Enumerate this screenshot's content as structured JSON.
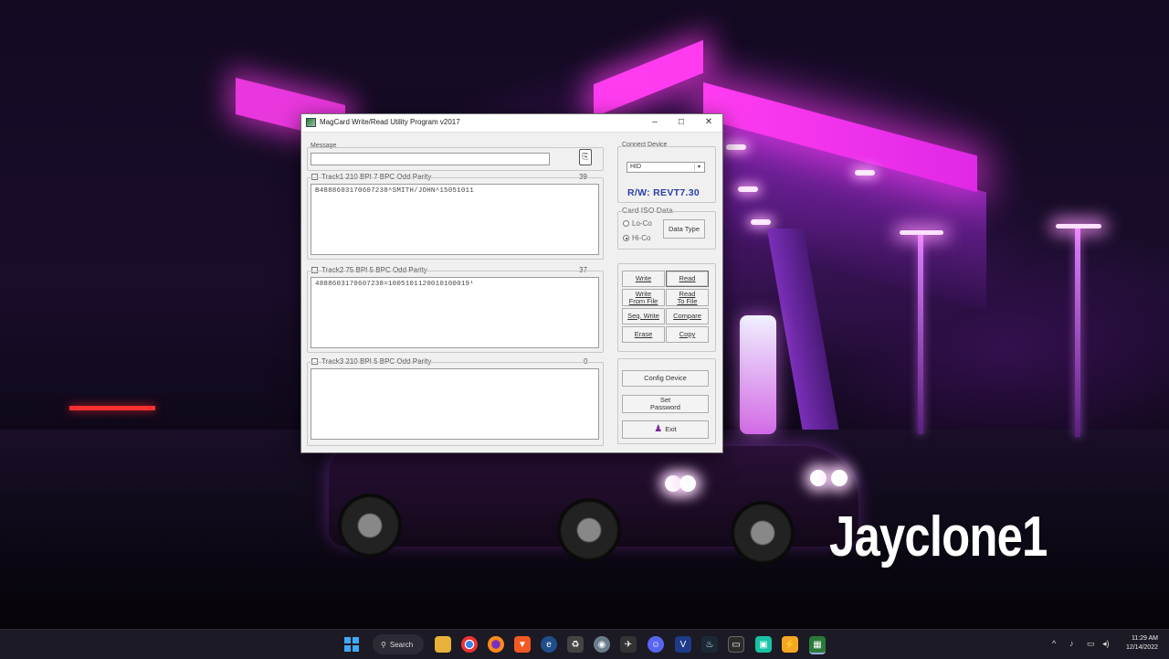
{
  "window": {
    "title": "MagCard Write/Read Utility Program  v2017",
    "controls": {
      "minimize": "–",
      "maximize": "☐",
      "close": "✕"
    }
  },
  "message": {
    "label": "Message",
    "value": ""
  },
  "tracks": [
    {
      "label": "Track1   210 BPI 7 BPC Odd Parity",
      "count": "39",
      "data": "B4888603170607238^SMITH/JOHN^15051011"
    },
    {
      "label": "Track2   75 BPI 5 BPC Odd Parity",
      "count": "37",
      "data": "4888603170607238=1005101120010100019¹"
    },
    {
      "label": "Track3   210 BPI 5 BPC Odd Parity",
      "count": "0",
      "data": ""
    }
  ],
  "connect": {
    "label": "Connect Device",
    "device": "HID",
    "version": "R/W: REVT7.30"
  },
  "iso": {
    "label": "Card ISO Data",
    "options": [
      "Lo-Co",
      "Hi-Co"
    ],
    "selected": "Hi-Co",
    "data_type_button": "Data Type"
  },
  "actions": {
    "write": "Write",
    "read": "Read",
    "write_from_file": "Write\nFrom File",
    "read_to_file": "Read\nTo File",
    "seq_write": "Seq. Write",
    "compare": "Compare",
    "erase": "Erase",
    "copy": "Copy"
  },
  "config": {
    "config_device": "Config Device",
    "set_password": "Set\nPassword",
    "exit": "Exit"
  },
  "watermark": "Jayclone1",
  "taskbar": {
    "search": "Search",
    "time": "11:29 AM",
    "date": "12/14/2022"
  }
}
